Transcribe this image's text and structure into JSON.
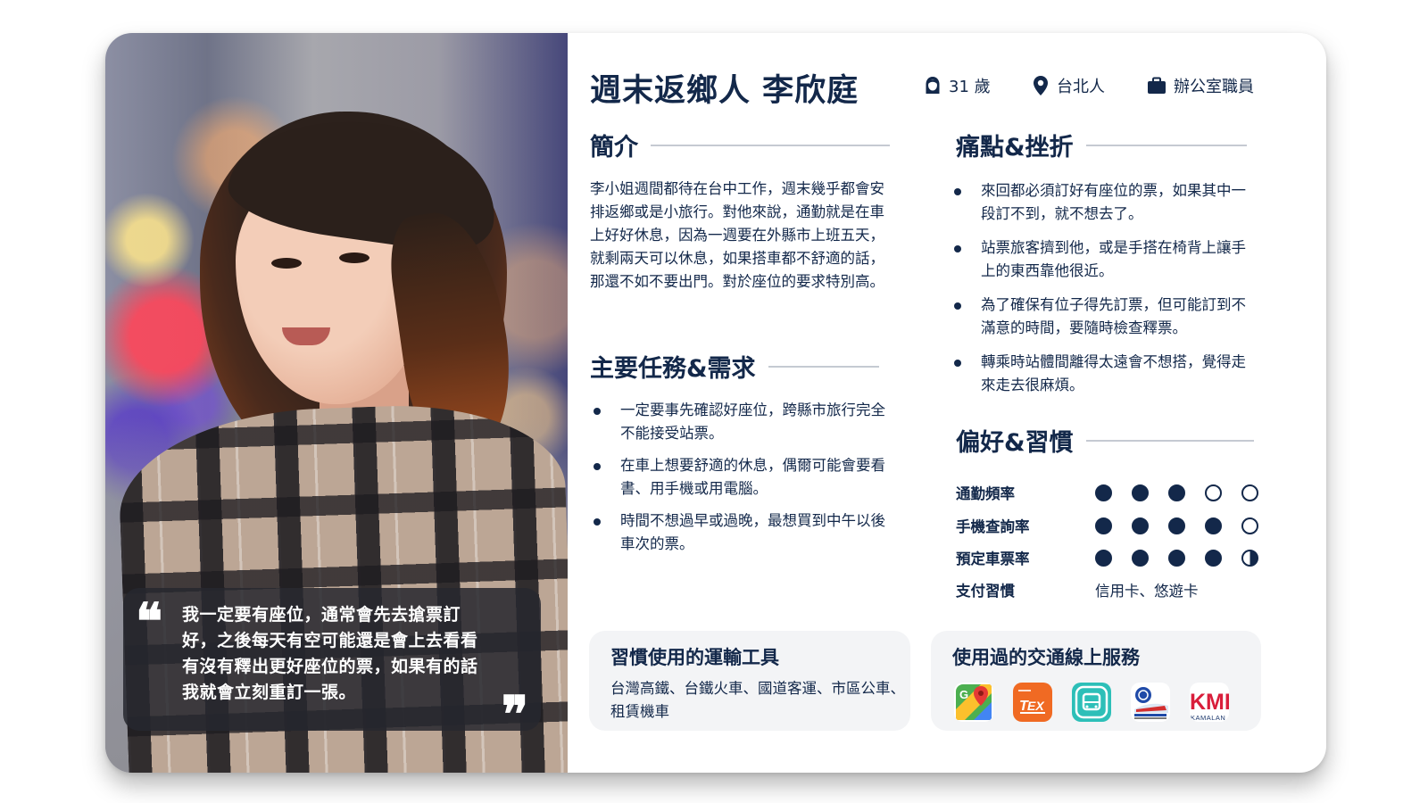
{
  "persona": {
    "name": "週末返鄉人 李欣庭",
    "age": "31 歲",
    "hometown": "台北人",
    "job": "辦公室職員"
  },
  "quote": {
    "open_mark": "❝",
    "close_mark": "❞",
    "text": "我一定要有座位，通常會先去搶票訂好，之後每天有空可能還是會上去看看有沒有釋出更好座位的票，如果有的話我就會立刻重訂一張。"
  },
  "intro": {
    "title": "簡介",
    "text": "李小姐週間都待在台中工作，週末幾乎都會安排返鄉或是小旅行。對他來說，通勤就是在車上好好休息，因為一週要在外縣市上班五天，就剩兩天可以休息，如果搭車都不舒適的話，那還不如不要出門。對於座位的要求特別高。"
  },
  "tasks": {
    "title": "主要任務&需求",
    "items": [
      "一定要事先確認好座位，跨縣市旅行完全不能接受站票。",
      "在車上想要舒適的休息，偶爾可能會要看書、用手機或用電腦。",
      "時間不想過早或過晚，最想買到中午以後車次的票。"
    ]
  },
  "pain_points": {
    "title": "痛點&挫折",
    "items": [
      "來回都必須訂好有座位的票，如果其中一段訂不到，就不想去了。",
      "站票旅客擠到他，或是手搭在椅背上讓手上的東西靠他很近。",
      "為了確保有位子得先訂票，但可能訂到不滿意的時間，要隨時檢查釋票。",
      "轉乘時站體間離得太遠會不想搭，覺得走來走去很麻煩。"
    ]
  },
  "preferences": {
    "title": "偏好&習慣",
    "rows": [
      {
        "label": "通勤頻率",
        "rating": 3,
        "max": 5
      },
      {
        "label": "手機查詢率",
        "rating": 4,
        "max": 5
      },
      {
        "label": "預定車票率",
        "rating": 4.5,
        "max": 5
      }
    ],
    "payment": {
      "label": "支付習慣",
      "value": "信用卡、悠遊卡"
    }
  },
  "transport": {
    "title": "習慣使用的運輸工具",
    "text": "台灣高鐵、台鐵火車、國道客運、市區公車、租賃機車"
  },
  "services": {
    "title": "使用過的交通線上服務",
    "apps": [
      "google-maps-icon",
      "thsr-tex-icon",
      "bus-app-icon",
      "railway-app-icon",
      "kml-icon"
    ],
    "kml_label": "KML",
    "kml_sub": "KAMALAN"
  },
  "colors": {
    "navy": "#13284a",
    "box_bg": "#f3f4f6",
    "quote_bg": "#26282e"
  }
}
